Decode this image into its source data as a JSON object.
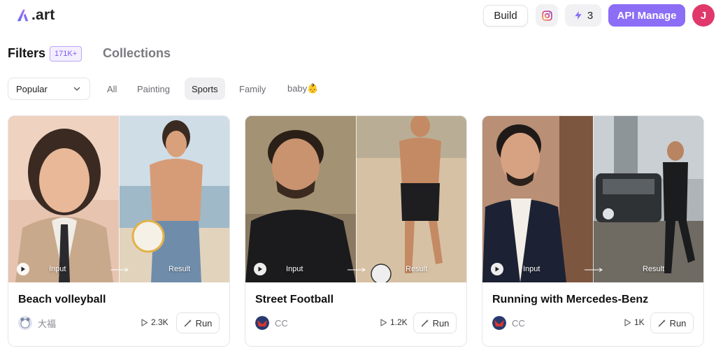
{
  "header": {
    "logo_text": ".art",
    "build_label": "Build",
    "credits": "3",
    "api_label": "API Manage",
    "avatar_initial": "J",
    "accent_color": "#8b6df6"
  },
  "tabs": {
    "filters": "Filters",
    "filters_count": "171K+",
    "collections": "Collections"
  },
  "filter_bar": {
    "sort_value": "Popular",
    "chips": [
      "All",
      "Painting",
      "Sports",
      "Family",
      "baby👶"
    ],
    "active_chip": "Sports"
  },
  "card_labels": {
    "input": "Input",
    "result": "Result",
    "run": "Run"
  },
  "cards": [
    {
      "title": "Beach volleyball",
      "author": "大福",
      "plays": "2.3K"
    },
    {
      "title": "Street Football",
      "author": "CC",
      "plays": "1.2K"
    },
    {
      "title": "Running with Mercedes-Benz",
      "author": "CC",
      "plays": "1K"
    }
  ]
}
